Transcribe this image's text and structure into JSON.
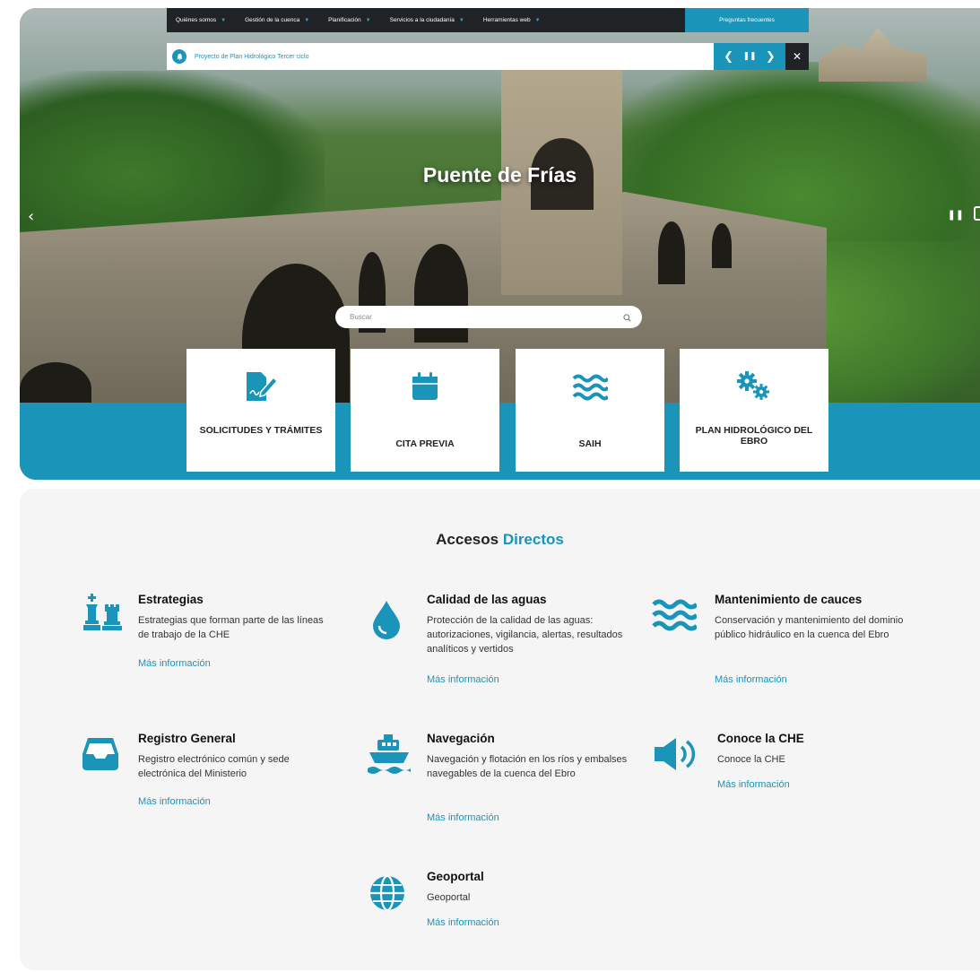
{
  "colors": {
    "accent": "#1a94b8",
    "nav_bg": "#1f2326",
    "section_bg": "#f5f5f5"
  },
  "nav": {
    "items": [
      {
        "label": "Quiénes somos",
        "icon": "chevron-down-icon"
      },
      {
        "label": "Gestión de la cuenca",
        "icon": "chevron-down-icon"
      },
      {
        "label": "Planificación",
        "icon": "chevron-down-icon"
      },
      {
        "label": "Servicios a la ciudadanía",
        "icon": "chevron-down-icon"
      },
      {
        "label": "Herramientas web",
        "icon": "chevron-down-icon"
      }
    ],
    "faq_label": "Preguntas frecuentes"
  },
  "ticker": {
    "text": "Proyecto de Plan Hidrológico Tercer ciclo",
    "icon": "bell-icon",
    "prev_glyph": "❮",
    "pause_glyph": "❚❚",
    "next_glyph": "❯",
    "close_glyph": "✕"
  },
  "hero": {
    "title": "Puente de Frías",
    "prev_glyph": "‹",
    "pause_glyph": "❚❚"
  },
  "search": {
    "placeholder": "Buscar",
    "icon": "search-icon"
  },
  "cards": [
    {
      "label": "SOLICITUDES Y TRÁMITES",
      "icon": "document-edit-icon"
    },
    {
      "label": "CITA PREVIA",
      "icon": "calendar-icon"
    },
    {
      "label": "SAIH",
      "icon": "waves-icon"
    },
    {
      "label": "PLAN HIDROLÓGICO DEL EBRO",
      "icon": "gears-icon"
    }
  ],
  "accesos": {
    "title_main": "Accesos",
    "title_accent": "Directos",
    "items": [
      {
        "title": "Estrategias",
        "desc": "Estrategias que forman parte de las líneas de trabajo de la CHE",
        "link": "Más información",
        "icon": "chess-icon"
      },
      {
        "title": "Calidad de las aguas",
        "desc": "Protección de la calidad de las aguas: autorizaciones, vigilancia, alertas, resultados analíticos y vertidos",
        "link": "Más información",
        "icon": "water-drop-icon"
      },
      {
        "title": "Mantenimiento de cauces",
        "desc": "Conservación y mantenimiento del dominio público hidráulico en la cuenca del Ebro",
        "link": "Más información",
        "icon": "waves-icon"
      },
      {
        "title": "Registro General",
        "desc": "Registro electrónico común y sede electrónica del Ministerio",
        "link": "Más información",
        "icon": "inbox-tray-icon"
      },
      {
        "title": "Navegación",
        "desc": "Navegación y flotación en los ríos y embalses navegables de la cuenca del Ebro",
        "link": "Más información",
        "icon": "ship-icon"
      },
      {
        "title": "Conoce la CHE",
        "desc": "Conoce la CHE",
        "link": "Más información",
        "icon": "speaker-icon"
      },
      {
        "title": "Geoportal",
        "desc": "Geoportal",
        "link": "Más información",
        "icon": "globe-icon"
      }
    ]
  }
}
